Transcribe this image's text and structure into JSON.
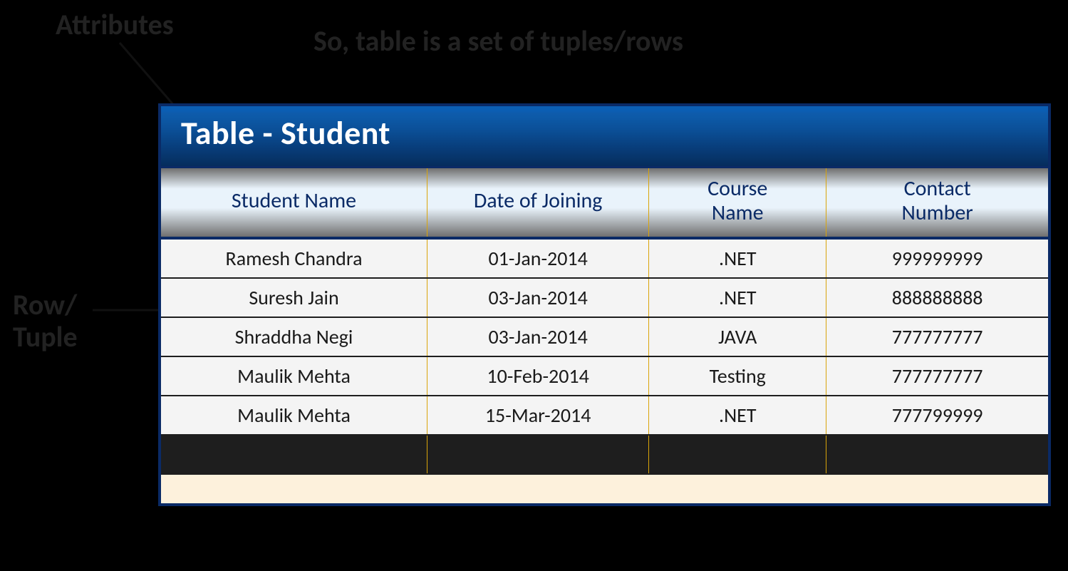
{
  "annotations": {
    "attributes_label": "Attributes",
    "row_tuple_line1": "Row/",
    "row_tuple_line2": "Tuple",
    "caption": "So, table is a set of tuples/rows"
  },
  "table": {
    "title": "Table - Student",
    "columns": [
      "Student Name",
      "Date of Joining",
      "Course Name",
      "Contact Number"
    ],
    "rows": [
      {
        "name": "Ramesh Chandra",
        "doj": "01-Jan-2014",
        "course": ".NET",
        "contact": "999999999"
      },
      {
        "name": "Suresh Jain",
        "doj": "03-Jan-2014",
        "course": ".NET",
        "contact": "888888888"
      },
      {
        "name": "Shraddha Negi",
        "doj": "03-Jan-2014",
        "course": "JAVA",
        "contact": "777777777"
      },
      {
        "name": "Maulik Mehta",
        "doj": "10-Feb-2014",
        "course": "Testing",
        "contact": "777777777"
      },
      {
        "name": "Maulik Mehta",
        "doj": "15-Mar-2014",
        "course": ".NET",
        "contact": "777799999"
      }
    ]
  }
}
